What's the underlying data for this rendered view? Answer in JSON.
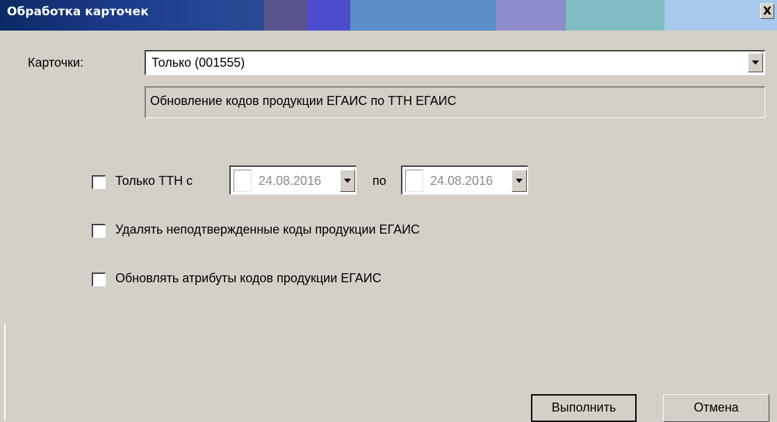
{
  "window": {
    "title": "Обработка карточек",
    "close_glyph": "X",
    "title_gradient": [
      "#17336d",
      "#1d3d8c",
      "#2a4c95",
      "#5a568d",
      "#4d4ccd",
      "#4a80c0",
      "#5a8ec8",
      "#8e8bcb",
      "#7ebec2",
      "#7dc0c6",
      "#a7c9ec"
    ]
  },
  "cards": {
    "label": "Карточки:",
    "selected": "Только (001555)",
    "description": "Обновление кодов продукции ЕГАИС по ТТН ЕГАИС"
  },
  "options": {
    "only_ttn": {
      "label": "Только ТТН с",
      "checked": false
    },
    "between_label": "по",
    "date_from": "24.08.2016",
    "date_to": "24.08.2016",
    "delete_unconfirmed": {
      "label": "Удалять неподтвержденные коды продукции ЕГАИС",
      "checked": false
    },
    "update_attributes": {
      "label": "Обновлять атрибуты кодов продукции ЕГАИС",
      "checked": false
    }
  },
  "buttons": {
    "execute": "Выполнить",
    "cancel": "Отмена"
  }
}
